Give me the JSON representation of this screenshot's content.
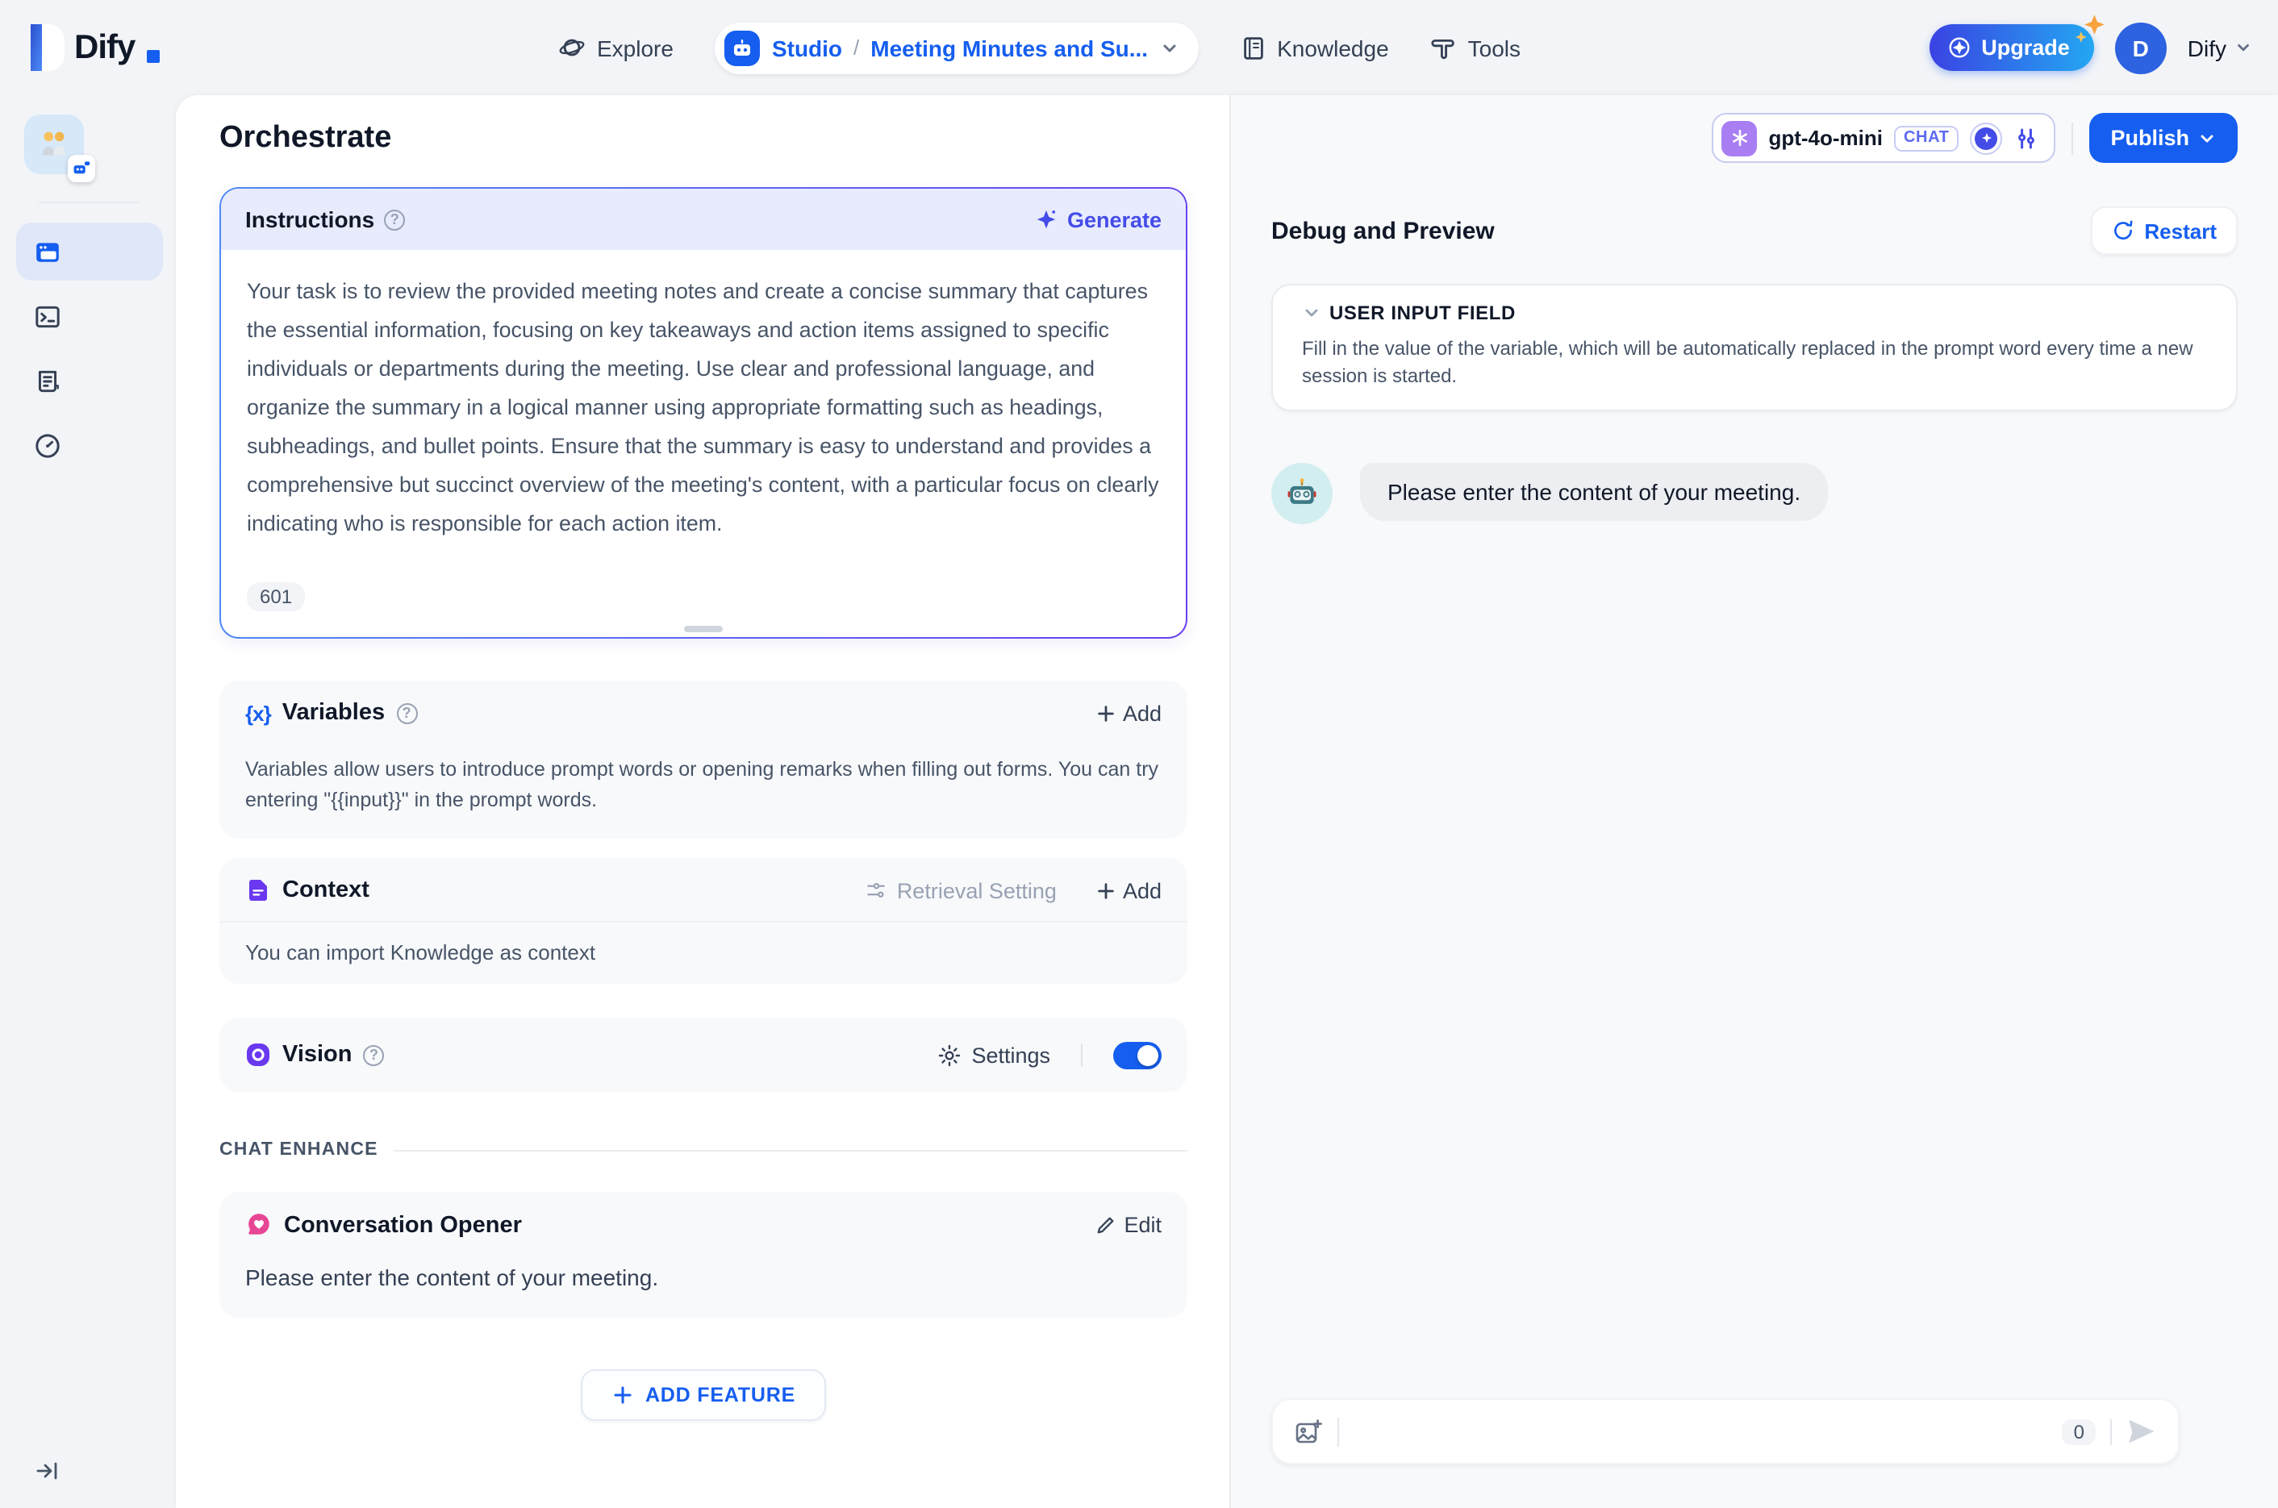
{
  "header": {
    "logo_text": "Dify",
    "nav": {
      "explore_label": "Explore",
      "studio_label": "Studio",
      "breadcrumb_separator": "/",
      "app_name": "Meeting Minutes and Su...",
      "knowledge_label": "Knowledge",
      "tools_label": "Tools"
    },
    "upgrade_label": "Upgrade",
    "account": {
      "avatar_initial": "D",
      "name": "Dify"
    }
  },
  "sidebar": {
    "app_icon": "two-people-emoji",
    "app_badge_icon": "chatbot",
    "items": [
      "orchestrate",
      "api-access",
      "logs-annotations",
      "monitoring"
    ],
    "expand_icon": "expand-sidebar"
  },
  "config": {
    "title": "Orchestrate",
    "instructions": {
      "title": "Instructions",
      "generate_label": "Generate",
      "body": "Your task is to review the provided meeting notes and create a concise summary that captures the essential information, focusing on key takeaways and action items assigned to specific individuals or departments during the meeting. Use clear and professional language, and organize the summary in a logical manner using appropriate formatting such as headings, subheadings, and bullet points. Ensure that the summary is easy to understand and provides a comprehensive but succinct overview of the meeting's content, with a particular focus on clearly indicating who is responsible for each action item.",
      "char_count": "601"
    },
    "variables": {
      "title": "Variables",
      "add_label": "Add",
      "description": "Variables allow users to introduce prompt words or opening remarks when filling out forms. You can try entering \"{{input}}\" in the prompt words."
    },
    "context": {
      "title": "Context",
      "retrieval_setting_label": "Retrieval Setting",
      "add_label": "Add",
      "empty_hint": "You can import Knowledge as context"
    },
    "vision": {
      "title": "Vision",
      "settings_label": "Settings",
      "enabled": true
    },
    "chat_enhance": {
      "section_label": "CHAT ENHANCE",
      "conversation_opener": {
        "title": "Conversation Opener",
        "edit_label": "Edit",
        "message": "Please enter the content of your meeting."
      },
      "add_feature_label": "ADD FEATURE"
    }
  },
  "model_bar": {
    "model_name": "gpt-4o-mini",
    "mode_badge": "CHAT",
    "publish_label": "Publish"
  },
  "debug": {
    "title": "Debug and Preview",
    "restart_label": "Restart",
    "user_input_field": {
      "title": "USER INPUT FIELD",
      "description": "Fill in the value of the variable, which will be automatically replaced in the prompt word every time a new session is started."
    },
    "bot_message": "Please enter the content of your meeting.",
    "chat_input": {
      "char_count": "0"
    }
  },
  "colors": {
    "accent_blue": "#155eef",
    "accent_indigo": "#444ce7",
    "accent_purple": "#6938ef",
    "opener_pink": "#e74694",
    "instructions_border_gradient": [
      "#4e8af6",
      "#6940ee"
    ],
    "upgrade_gradient": [
      "#3a43e3",
      "#23a7f2"
    ]
  }
}
